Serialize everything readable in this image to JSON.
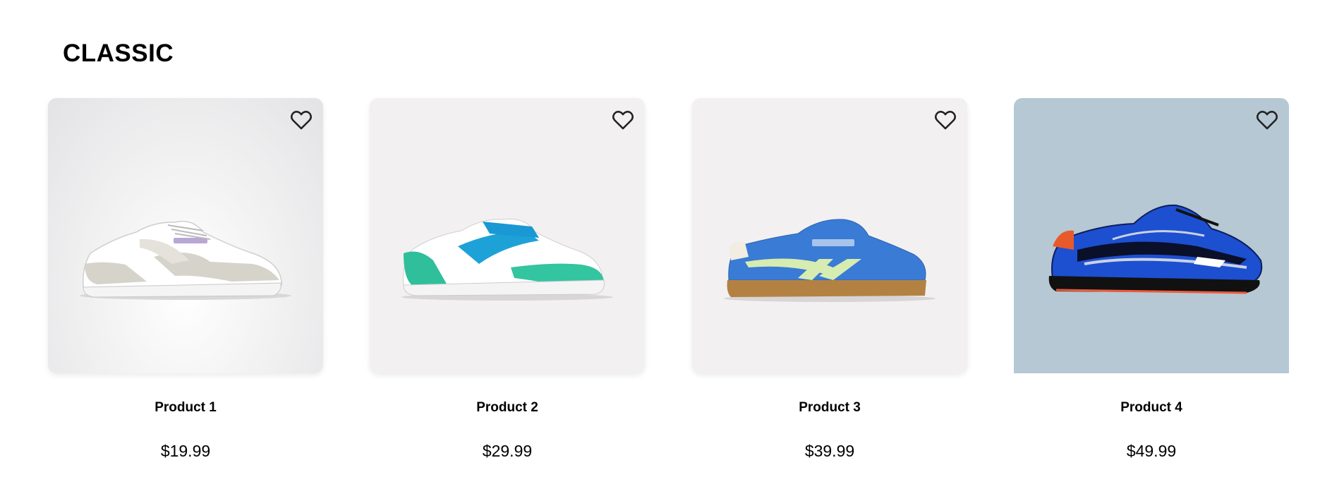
{
  "section": {
    "title": "CLASSIC"
  },
  "products": [
    {
      "name": "Product 1",
      "price": "$19.99",
      "image": "white-grey-classic-sneaker",
      "favorite_icon": "heart-outline-icon"
    },
    {
      "name": "Product 2",
      "price": "$29.99",
      "image": "white-teal-blue-leather-sneaker",
      "favorite_icon": "heart-outline-icon"
    },
    {
      "name": "Product 3",
      "price": "$39.99",
      "image": "blue-suede-gum-sole-sneaker",
      "favorite_icon": "heart-outline-icon"
    },
    {
      "name": "Product 4",
      "price": "$49.99",
      "image": "blue-black-running-shoe",
      "favorite_icon": "heart-outline-icon"
    }
  ],
  "colors": {
    "card_bg_light": "#f2f0f1",
    "card_bg_blue": "#b6c8d3",
    "text": "#000000",
    "icon": "#222222"
  }
}
